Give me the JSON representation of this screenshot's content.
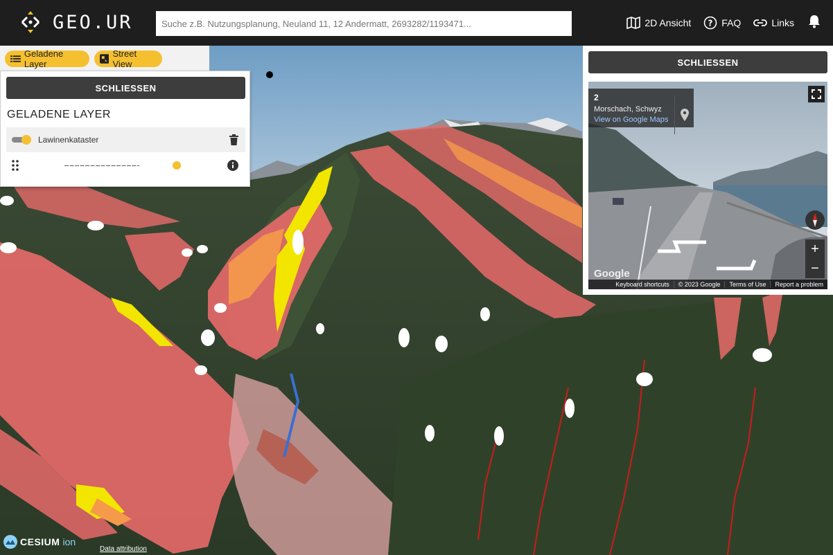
{
  "header": {
    "logo_text": "GEO.UR",
    "search_placeholder": "Suche z.B. Nutzungsplanung, Neuland 11, 12 Andermatt, 2693282/1193471...",
    "nav": [
      {
        "label": "2D Ansicht",
        "icon": "map-icon"
      },
      {
        "label": "FAQ",
        "icon": "help-icon"
      },
      {
        "label": "Links",
        "icon": "link-icon"
      }
    ],
    "notifications_icon": "bell-icon"
  },
  "tabs": {
    "loaded_layers": "Geladene Layer",
    "street_view": "Street View"
  },
  "layer_panel": {
    "close_label": "SCHLIESSEN",
    "title": "GELADENE LAYER",
    "layers": [
      {
        "name": "Lawinenkataster",
        "visible": true,
        "opacity": 1.0
      }
    ]
  },
  "street_view": {
    "close_label": "SCHLIESSEN",
    "number": "2",
    "location": "Morschach, Schwyz",
    "link": "View on Google Maps",
    "brand": "Google",
    "footer": [
      "Keyboard shortcuts",
      "© 2023 Google",
      "Terms of Use",
      "Report a problem"
    ]
  },
  "footer": {
    "cesium": "CESIUM",
    "ion": "ion",
    "attribution": "Data attribution"
  },
  "colors": {
    "header_bg": "#1e1e1e",
    "accent": "#f5c030",
    "button_dark": "#3d3d3d",
    "hazard_red": "#e86a6a",
    "hazard_orange": "#f59a4a",
    "hazard_yellow": "#f2e600"
  }
}
